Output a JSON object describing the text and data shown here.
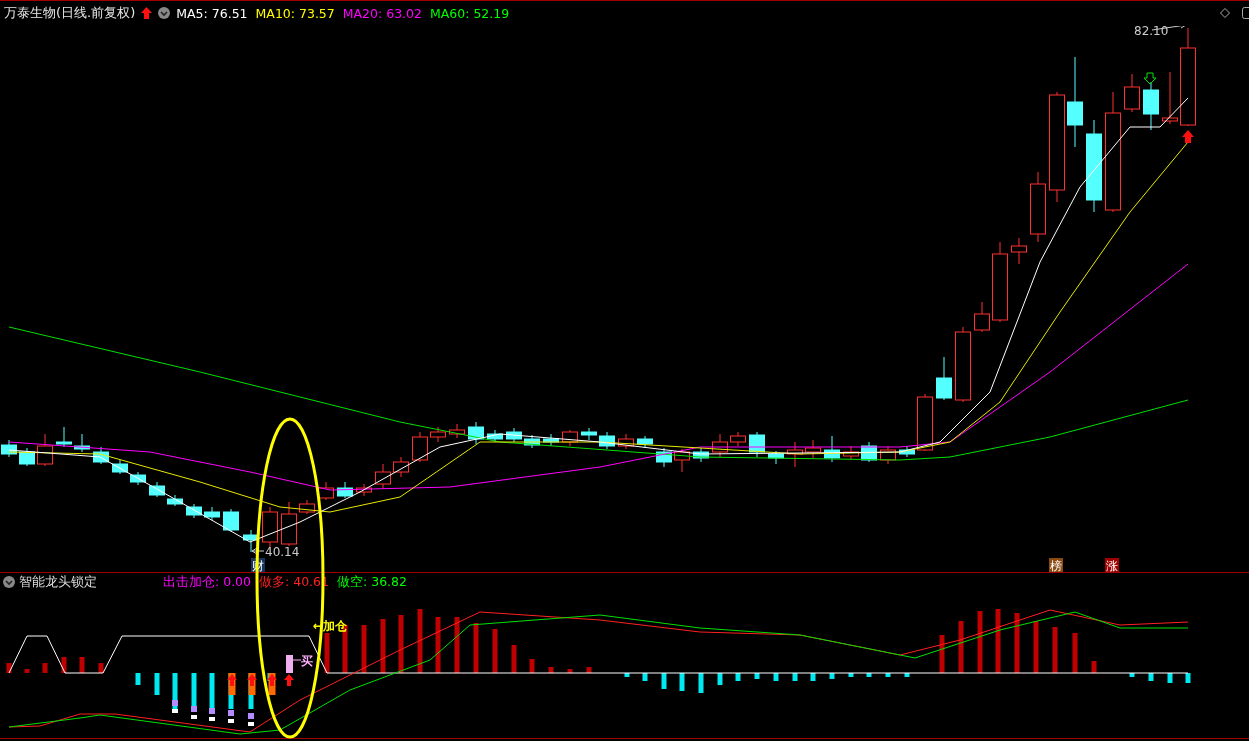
{
  "header": {
    "title": "万泰生物(日线.前复权)",
    "ma": [
      {
        "label": "MA5: 76.51",
        "color": "#ffffff"
      },
      {
        "label": "MA10: 73.57",
        "color": "#ffff00"
      },
      {
        "label": "MA20: 63.02",
        "color": "#ff00ff"
      },
      {
        "label": "MA60: 52.19",
        "color": "#00ff00"
      }
    ]
  },
  "price_chart": {
    "high_label": "82.10",
    "low_label": "40.14",
    "badges": [
      {
        "text": "财",
        "color": "#17345f"
      },
      {
        "text": "榜",
        "color": "#8a4a10"
      },
      {
        "text": "涨",
        "color": "#a00000"
      }
    ]
  },
  "indicator": {
    "title": "智能龙头锁定",
    "legend": [
      {
        "label": "出击加仓: 0.00",
        "color": "#ff00ff"
      },
      {
        "label": "做多: 40.61",
        "color": "#ff2020"
      },
      {
        "label": "做空: 36.82",
        "color": "#00ff00"
      }
    ],
    "signals": [
      {
        "text": "←加仓",
        "color": "#ffff00"
      },
      {
        "text": "买",
        "color": "#ffb0ff"
      }
    ]
  }
}
